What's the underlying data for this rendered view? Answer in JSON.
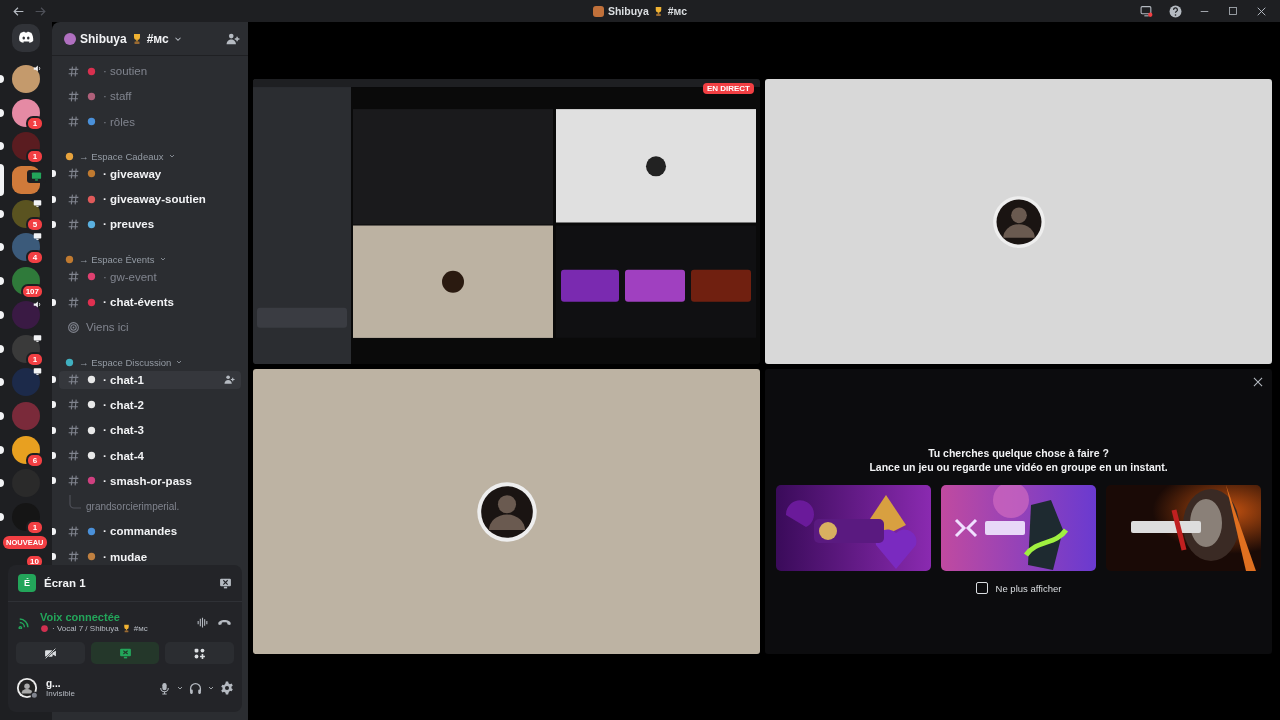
{
  "titlebar": {
    "nav": [
      {
        "kind": "back",
        "disabled": false
      },
      {
        "kind": "forward",
        "disabled": true
      }
    ],
    "server_name": "Shibuya",
    "channel_tag": "#мс"
  },
  "servers": [
    {
      "color": "#c49a6c",
      "unread": true,
      "selected": false,
      "kind": "voice"
    },
    {
      "color": "#e58aa4",
      "unread": true,
      "selected": false,
      "kind": "plain",
      "badge": "1"
    },
    {
      "color": "#5a1c20",
      "unread": true,
      "selected": false,
      "kind": "plain",
      "badge": "1"
    },
    {
      "color": "#d07a3a",
      "unread": false,
      "selected": true,
      "kind": "stream"
    },
    {
      "color": "#5a5320",
      "unread": true,
      "selected": false,
      "kind": "screen",
      "badge": "5"
    },
    {
      "color": "#3b5a7a",
      "unread": true,
      "selected": false,
      "kind": "screen",
      "badge": "4"
    },
    {
      "color": "#2f7a3a",
      "unread": true,
      "selected": false,
      "kind": "plain",
      "badge": "107"
    },
    {
      "color": "#3a1a44",
      "unread": true,
      "selected": false,
      "kind": "voice"
    },
    {
      "color": "#3a3a3a",
      "unread": true,
      "selected": false,
      "kind": "screen",
      "badge": "1"
    },
    {
      "color": "#1c2a4a",
      "unread": true,
      "selected": false,
      "kind": "screen"
    },
    {
      "color": "#7a2a3a",
      "unread": true,
      "selected": false,
      "kind": "plain"
    },
    {
      "color": "#e8a020",
      "unread": true,
      "selected": false,
      "kind": "plain",
      "badge": "6"
    },
    {
      "color": "#2a2a2a",
      "unread": true,
      "selected": false,
      "kind": "plain"
    },
    {
      "color": "#151515",
      "unread": true,
      "selected": false,
      "kind": "plain",
      "badge": "1"
    },
    {
      "unread": false,
      "selected": false,
      "kind": "new",
      "tag": "NOUVEAU",
      "badge": "10"
    }
  ],
  "sidebar": {
    "server_name": "Shibuya",
    "channel_tag": "#мс",
    "items": [
      {
        "kind": "text",
        "label": "· soutien",
        "color": "#d9304f",
        "unread": false,
        "hovered": false
      },
      {
        "kind": "text",
        "label": "· staff",
        "color": "#b0607a",
        "unread": false,
        "hovered": false
      },
      {
        "kind": "text",
        "label": "· rôles",
        "color": "#4a90d9",
        "unread": false,
        "hovered": false
      },
      {
        "kind": "category",
        "label": "→ Espace Cadeaux",
        "color": "#e8a33d"
      },
      {
        "kind": "text",
        "label": "· giveaway",
        "color": "#c07a30",
        "unread": true,
        "hovered": false
      },
      {
        "kind": "text",
        "label": "· giveaway-soutien",
        "color": "#e05a5a",
        "unread": true,
        "hovered": false
      },
      {
        "kind": "text",
        "label": "· preuves",
        "color": "#5ab0e0",
        "unread": true,
        "hovered": false
      },
      {
        "kind": "category",
        "label": "→ Espace Évents",
        "color": "#c07a30"
      },
      {
        "kind": "text",
        "label": "· gw-event",
        "color": "#e04070",
        "unread": false,
        "hovered": false
      },
      {
        "kind": "text",
        "label": "· chat-évents",
        "color": "#e03050",
        "unread": true,
        "hovered": false
      },
      {
        "kind": "voice",
        "label": "Viens ici"
      },
      {
        "kind": "category",
        "label": "→ Espace Discussion",
        "color": "#40b0c0"
      },
      {
        "kind": "text",
        "label": "· chat-1",
        "color": "#e8e8e8",
        "unread": true,
        "hovered": true
      },
      {
        "kind": "text",
        "label": "· chat-2",
        "color": "#e8e8e8",
        "unread": true,
        "hovered": false
      },
      {
        "kind": "text",
        "label": "· chat-3",
        "color": "#e8e8e8",
        "unread": true,
        "hovered": false
      },
      {
        "kind": "text",
        "label": "· chat-4",
        "color": "#e8e8e8",
        "unread": true,
        "hovered": false
      },
      {
        "kind": "text",
        "label": "· smash-or-pass",
        "color": "#d04080",
        "unread": true,
        "hovered": false
      },
      {
        "kind": "thread",
        "label": "grandsorcierimperial."
      },
      {
        "kind": "text",
        "label": "· commandes",
        "color": "#4a90d9",
        "unread": true,
        "hovered": false
      },
      {
        "kind": "text",
        "label": "· mudae",
        "color": "#c08040",
        "unread": true,
        "hovered": false
      }
    ]
  },
  "voice_panel": {
    "stream": {
      "initial": "É",
      "label": "Écran 1"
    },
    "status": "Voix connectée",
    "channel": "· Vocal 7 / Shibuya",
    "channel_tag": "#мс",
    "controls": [
      {
        "kind": "camera",
        "on": false
      },
      {
        "kind": "screen",
        "on": true
      },
      {
        "kind": "activities",
        "on": false
      }
    ]
  },
  "user": {
    "name": "g...",
    "status": "Invisible"
  },
  "stage": {
    "tiles": [
      {
        "kind": "stream",
        "badge": "EN DIRECT"
      },
      {
        "kind": "avatar",
        "color": "#d8d8d8"
      },
      {
        "kind": "avatar",
        "color": "#bdb3a3"
      },
      {
        "kind": "activities",
        "title": "Tu cherches quelque chose à faire ?",
        "subtitle": "Lance un jeu ou regarde une vidéo en groupe en un instant.",
        "dismiss": {
          "label": "Ne plus afficher",
          "checked": false
        }
      }
    ]
  }
}
